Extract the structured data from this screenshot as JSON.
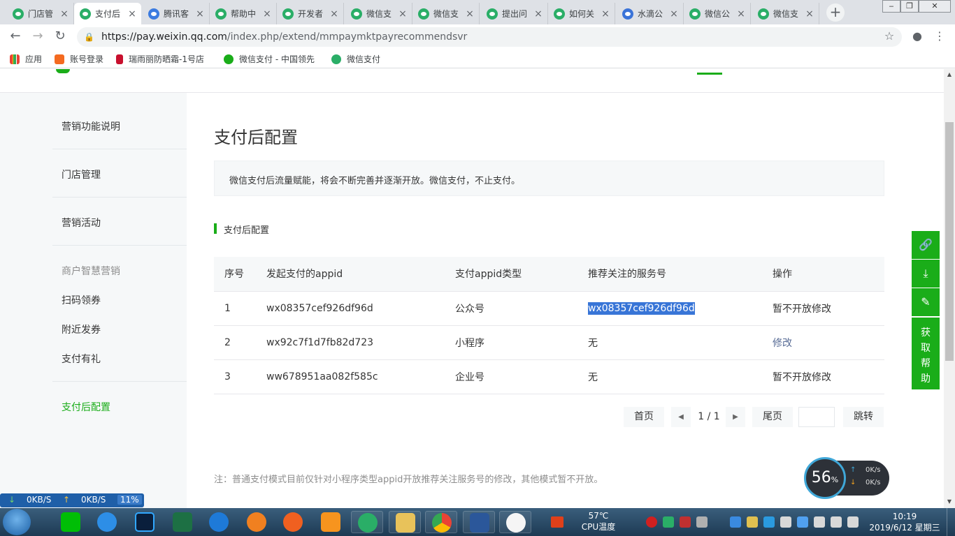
{
  "tabs": [
    {
      "title": "门店管",
      "icon": "wechat-icon"
    },
    {
      "title": "支付后",
      "icon": "wechat-icon",
      "active": true
    },
    {
      "title": "腾讯客",
      "icon": "tencent-icon"
    },
    {
      "title": "帮助中",
      "icon": "wechat-icon"
    },
    {
      "title": "开发者",
      "icon": "wechat-icon"
    },
    {
      "title": "微信支",
      "icon": "wechat-icon"
    },
    {
      "title": "微信支",
      "icon": "wechat-icon"
    },
    {
      "title": "提出问",
      "icon": "wechat-icon"
    },
    {
      "title": "如何关",
      "icon": "wechat-icon"
    },
    {
      "title": "水滴公",
      "icon": "baidu-icon"
    },
    {
      "title": "微信公",
      "icon": "wechat-icon"
    },
    {
      "title": "微信支",
      "icon": "wechat-icon"
    }
  ],
  "address": {
    "host": "https://pay.weixin.qq.com",
    "path": "/index.php/extend/mmpaymktpayrecommendsvr"
  },
  "bookmarks": [
    {
      "label": "应用",
      "icon": "apps-icon"
    },
    {
      "label": "账号登录",
      "icon": "login-icon"
    },
    {
      "label": "瑞雨丽防晒霜-1号店",
      "icon": "store-icon"
    },
    {
      "label": "微信支付 - 中国领先",
      "icon": "wechat-pay-icon"
    },
    {
      "label": "微信支付",
      "icon": "wechat-icon"
    }
  ],
  "sidebar": {
    "items": [
      {
        "label": "营销功能说明"
      },
      {
        "label": "门店管理"
      },
      {
        "label": "营销活动"
      },
      {
        "label": "商户智慧营销",
        "group": true
      },
      {
        "label": "扫码领券"
      },
      {
        "label": "附近发券"
      },
      {
        "label": "支付有礼"
      },
      {
        "label": "支付后配置",
        "active": true
      }
    ]
  },
  "main": {
    "title": "支付后配置",
    "notice": "微信支付后流量赋能，将会不断完善并逐渐开放。微信支付，不止支付。",
    "section_title": "支付后配置",
    "table": {
      "headers": [
        "序号",
        "发起支付的appid",
        "支付appid类型",
        "推荐关注的服务号",
        "操作"
      ],
      "rows": [
        {
          "no": "1",
          "appid": "wx08357cef926df96d",
          "type": "公众号",
          "service": "wx08357cef926df96d",
          "action": "暂不开放修改"
        },
        {
          "no": "2",
          "appid": "wx92c7f1d7fb82d723",
          "type": "小程序",
          "service": "无",
          "action": "修改"
        },
        {
          "no": "3",
          "appid": "ww678951aa082f585c",
          "type": "企业号",
          "service": "无",
          "action": "暂不开放修改"
        }
      ]
    },
    "pager": {
      "first": "首页",
      "page": "1 / 1",
      "last": "尾页",
      "jump": "跳转",
      "current_page": 1,
      "total_pages": 1
    },
    "footnote": "注：普通支付模式目前仅针对小程序类型appid开放推荐关注服务号的修改，其他模式暂不开放。"
  },
  "floatbar": {
    "help_label": "获\n取\n帮\n助"
  },
  "speed_widget": {
    "percent": "56",
    "unit": "%",
    "up": "0K/s",
    "down": "0K/s"
  },
  "netmeter": {
    "down": "0KB/S",
    "up": "0KB/S",
    "percent": "11%"
  },
  "taskbar": {
    "cpu_temp": "57℃",
    "cpu_label": "CPU温度",
    "time": "10:19",
    "date": "2019/6/12 星期三"
  },
  "colors": {
    "brand": "#1aad19",
    "link": "#576b95",
    "selection": "#3875d7"
  }
}
